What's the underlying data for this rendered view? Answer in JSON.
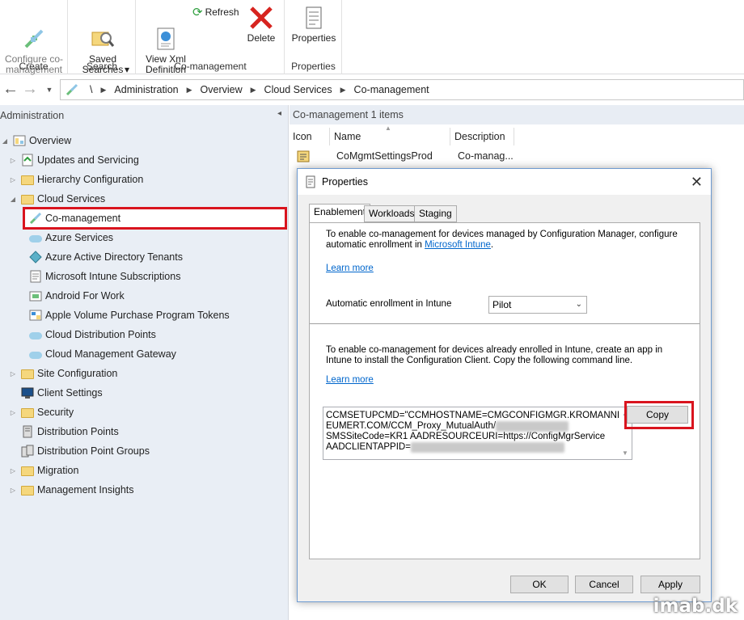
{
  "ribbon": {
    "create": {
      "button": "Configure co-\nmanagement",
      "group": "Create"
    },
    "search": {
      "button": "Saved\nSearches",
      "group": "Search",
      "dropdown": "▾"
    },
    "comanagement": {
      "view_xml": "View Xml\nDefinition",
      "refresh": "Refresh",
      "delete": "Delete",
      "group": "Co-management"
    },
    "properties": {
      "button": "Properties",
      "group": "Properties"
    }
  },
  "address": {
    "root": "\\",
    "crumbs": [
      "Administration",
      "Overview",
      "Cloud Services",
      "Co-management"
    ]
  },
  "nav": {
    "header": "Administration",
    "collapse": "◂",
    "items": [
      {
        "label": "Overview",
        "expand": "◢"
      },
      {
        "label": "Updates and Servicing",
        "expand": "▷"
      },
      {
        "label": "Hierarchy Configuration",
        "expand": "▷"
      },
      {
        "label": "Cloud Services",
        "expand": "◢"
      },
      {
        "label": "Co-management"
      },
      {
        "label": "Azure Services"
      },
      {
        "label": "Azure Active Directory Tenants"
      },
      {
        "label": "Microsoft Intune Subscriptions"
      },
      {
        "label": "Android For Work"
      },
      {
        "label": "Apple Volume Purchase Program Tokens"
      },
      {
        "label": "Cloud Distribution Points"
      },
      {
        "label": "Cloud Management Gateway"
      },
      {
        "label": "Site Configuration",
        "expand": "▷"
      },
      {
        "label": "Client Settings"
      },
      {
        "label": "Security",
        "expand": "▷"
      },
      {
        "label": "Distribution Points"
      },
      {
        "label": "Distribution Point Groups"
      },
      {
        "label": "Migration",
        "expand": "▷"
      },
      {
        "label": "Management Insights",
        "expand": "▷"
      }
    ]
  },
  "list": {
    "header": "Co-management 1 items",
    "columns": [
      "Icon",
      "Name",
      "Description"
    ],
    "rows": [
      {
        "name": "CoMgmtSettingsProd",
        "description": "Co-manag..."
      }
    ]
  },
  "dialog": {
    "title": "Properties",
    "close": "✕",
    "tabs": [
      "Enablement",
      "Workloads",
      "Staging"
    ],
    "intro_text": "To enable co-management for devices managed by Configuration Manager, configure automatic enrollment in ",
    "intro_link": "Microsoft Intune",
    "intro_end": ".",
    "learn_more_1": "Learn more",
    "auto_enroll_label": "Automatic enrollment in Intune",
    "auto_enroll_value": "Pilot",
    "section2_text": "To enable co-management for devices already enrolled in Intune, create an app in Intune to install the Configuration Client. Copy the following command line.",
    "learn_more_2": "Learn more",
    "command": {
      "line1": "CCMSETUPCMD=\"CCMHOSTNAME=CMGCONFIGMGR.KROMANNR",
      "line2": "EUMERT.COM/CCM_Proxy_MutualAuth/",
      "line2_redacted": "72057594037928",
      "line3": "SMSSiteCode=KR1 AADRESOURCEURI=https://ConfigMgrService",
      "line4": "AADCLIENTAPPID=",
      "line4_redacted": "5b1c2a3d-0000-4e7f-9999-aaaaaaaa"
    },
    "copy": "Copy",
    "ok": "OK",
    "cancel": "Cancel",
    "apply": "Apply"
  },
  "watermark": "imab.dk",
  "colors": {
    "highlight_red": "#d9141e",
    "nav_bg": "#e9eef5",
    "link": "#0066cc"
  }
}
